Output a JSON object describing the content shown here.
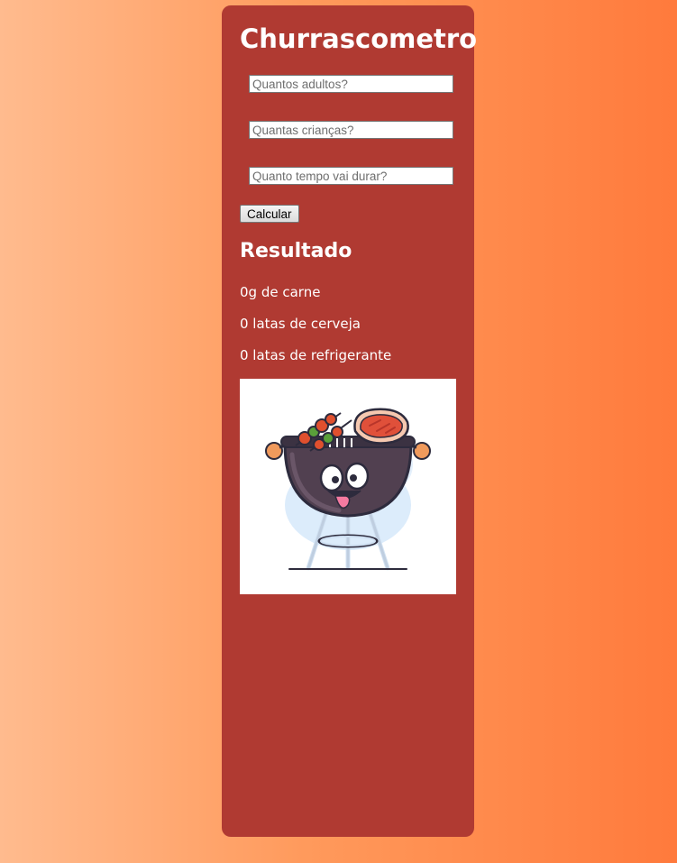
{
  "app": {
    "title": "Churrascometro"
  },
  "form": {
    "adults_placeholder": "Quantos adultos?",
    "children_placeholder": "Quantas crianças?",
    "duration_placeholder": "Quanto tempo vai durar?",
    "adults_value": "",
    "children_value": "",
    "duration_value": "",
    "calculate_label": "Calcular"
  },
  "result": {
    "title": "Resultado",
    "meat": "0g de carne",
    "beer": "0 latas de cerveja",
    "soda": "0 latas de refrigerante"
  },
  "image": {
    "icon": "grill-mascot-icon"
  },
  "colors": {
    "card": "#b03a32",
    "gradient_left": "#ffbb8e",
    "gradient_right": "#ff7a3c"
  }
}
